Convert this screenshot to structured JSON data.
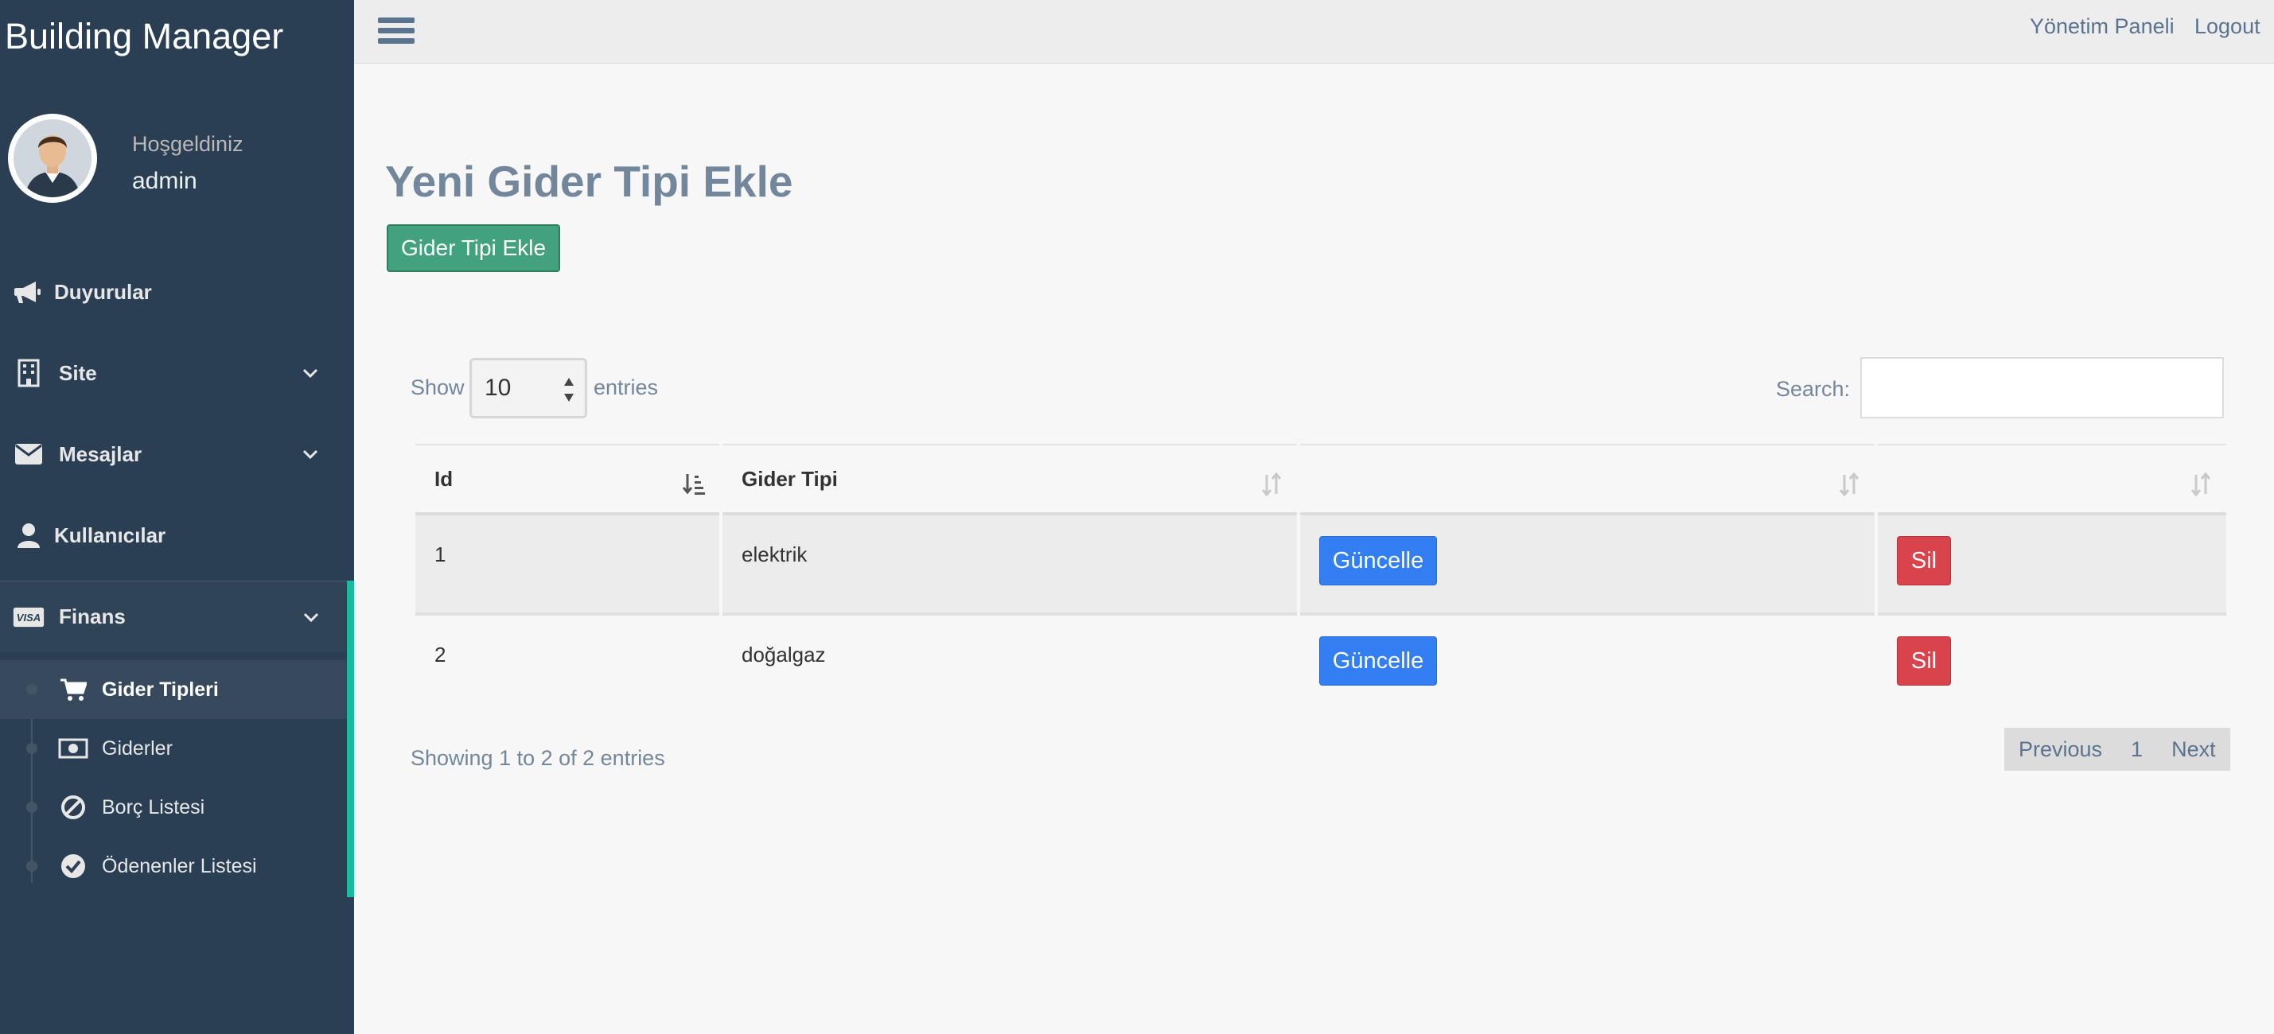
{
  "app": {
    "brand": "Building Manager"
  },
  "profile": {
    "welcome": "Hoşgeldiniz",
    "username": "admin"
  },
  "sidebar": {
    "items": [
      {
        "label": "Duyurular",
        "icon": "bullhorn-icon"
      },
      {
        "label": "Site",
        "icon": "building-icon",
        "expandable": true
      },
      {
        "label": "Mesajlar",
        "icon": "envelope-icon",
        "expandable": true
      },
      {
        "label": "Kullanıcılar",
        "icon": "user-icon"
      },
      {
        "label": "Finans",
        "icon": "visa-card-icon",
        "expandable": true,
        "active": true
      }
    ],
    "finans_sub": [
      {
        "label": "Gider Tipleri",
        "icon": "shopping-cart-icon",
        "current": true
      },
      {
        "label": "Giderler",
        "icon": "money-icon"
      },
      {
        "label": "Borç Listesi",
        "icon": "ban-icon"
      },
      {
        "label": "Ödenenler Listesi",
        "icon": "check-circle-icon"
      }
    ]
  },
  "topnav": {
    "panel_link": "Yönetim Paneli",
    "logout_link": "Logout"
  },
  "main": {
    "title": "Yeni Gider Tipi Ekle",
    "add_button": "Gider Tipi Ekle",
    "show_label": "Show",
    "page_size": "10",
    "entries_label": "entries",
    "search_label": "Search:",
    "search_value": "",
    "table": {
      "headers": [
        "Id",
        "Gider Tipi",
        "",
        ""
      ],
      "rows": [
        {
          "id": "1",
          "type": "elektrik",
          "update": "Güncelle",
          "delete": "Sil"
        },
        {
          "id": "2",
          "type": "doğalgaz",
          "update": "Güncelle",
          "delete": "Sil"
        }
      ]
    },
    "info": "Showing 1 to 2 of 2 entries",
    "pager": {
      "previous": "Previous",
      "page": "1",
      "next": "Next"
    }
  },
  "colors": {
    "sidebar_bg": "#2a3f54",
    "accent_green": "#1abb9c",
    "button_green": "#42a17e",
    "button_blue": "#337ef2",
    "button_red": "#d9434b",
    "text_muted": "#73879c"
  }
}
